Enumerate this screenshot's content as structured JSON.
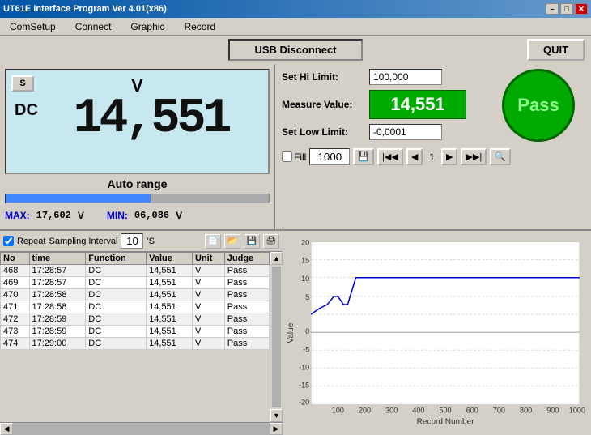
{
  "titleBar": {
    "title": "UT61E Interface Program Ver 4.01(x86)",
    "minimize": "–",
    "maximize": "□",
    "close": "✕"
  },
  "menu": {
    "items": [
      "ComSetup",
      "Connect",
      "Graphic",
      "Record"
    ]
  },
  "usbBar": {
    "usbLabel": "USB Disconnect",
    "quitLabel": "QUIT"
  },
  "meter": {
    "sBtn": "S",
    "unit": "V",
    "function": "DC",
    "value": "14,551",
    "autoRange": "Auto range"
  },
  "maxMin": {
    "maxLabel": "MAX:",
    "maxValue": "17,602",
    "maxUnit": "V",
    "minLabel": "MIN:",
    "minValue": "06,086",
    "minUnit": "V"
  },
  "limits": {
    "hiLimitLabel": "Set Hi Limit:",
    "hiLimitValue": "100,000",
    "measureLabel": "Measure Value:",
    "measureValue": "14,551",
    "lowLimitLabel": "Set Low Limit:",
    "lowLimitValue": "-0,0001",
    "passLabel": "Pass"
  },
  "controls": {
    "fillLabel": "Fill",
    "recordNum": "1000",
    "navFirst": "⊢|",
    "navPrev": "◀◀",
    "navPage": "1",
    "navNext": "▶▶",
    "navLast": "|⊣",
    "zoomIcon": "🔍"
  },
  "sampling": {
    "repeatLabel": "Repeat",
    "samplingLabel": "Sampling Interval",
    "samplingValue": "10",
    "unitLabel": "'S"
  },
  "tableHeaders": [
    "No",
    "time",
    "Function",
    "Value",
    "Unit",
    "Judge"
  ],
  "tableRows": [
    {
      "no": "468",
      "time": "17:28:57",
      "func": "DC",
      "value": "14,551",
      "unit": "V",
      "judge": "Pass"
    },
    {
      "no": "469",
      "time": "17:28:57",
      "func": "DC",
      "value": "14,551",
      "unit": "V",
      "judge": "Pass"
    },
    {
      "no": "470",
      "time": "17:28:58",
      "func": "DC",
      "value": "14,551",
      "unit": "V",
      "judge": "Pass"
    },
    {
      "no": "471",
      "time": "17:28:58",
      "func": "DC",
      "value": "14,551",
      "unit": "V",
      "judge": "Pass"
    },
    {
      "no": "472",
      "time": "17:28:59",
      "func": "DC",
      "value": "14,551",
      "unit": "V",
      "judge": "Pass"
    },
    {
      "no": "473",
      "time": "17:28:59",
      "func": "DC",
      "value": "14,551",
      "unit": "V",
      "judge": "Pass"
    },
    {
      "no": "474",
      "time": "17:29:00",
      "func": "DC",
      "value": "14,551",
      "unit": "V",
      "judge": "Pass"
    }
  ],
  "chart": {
    "yLabel": "Value",
    "xLabel": "Record Number",
    "yTicks": [
      "20",
      "15",
      "10",
      "5",
      "0",
      "-5",
      "-10",
      "-15",
      "-20"
    ],
    "xTicks": [
      "100",
      "200",
      "300",
      "400",
      "500",
      "600",
      "700",
      "800",
      "900",
      "1000"
    ]
  }
}
